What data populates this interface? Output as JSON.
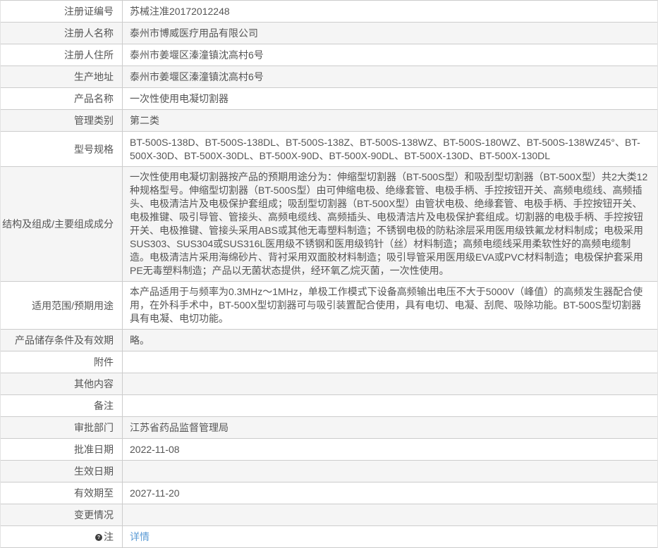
{
  "colors": {
    "link_blue": "#5b9bd5",
    "row_alt_gray": "#f5f5f5",
    "border_gray": "#cccccc",
    "text_gray": "#555555"
  },
  "table": {
    "rows": [
      {
        "label": "注册证编号",
        "value": "苏械注准20172012248"
      },
      {
        "label": "注册人名称",
        "value": "泰州市博威医疗用品有限公司"
      },
      {
        "label": "注册人住所",
        "value": "泰州市姜堰区溱潼镇沈高村6号"
      },
      {
        "label": "生产地址",
        "value": "泰州市姜堰区溱潼镇沈高村6号"
      },
      {
        "label": "产品名称",
        "value": "一次性使用电凝切割器"
      },
      {
        "label": "管理类别",
        "value": "第二类"
      },
      {
        "label": "型号规格",
        "value": "BT-500S-138D、BT-500S-138DL、BT-500S-138Z、BT-500S-138WZ、BT-500S-180WZ、BT-500S-138WZ45°、BT-500X-30D、BT-500X-30DL、BT-500X-90D、BT-500X-90DL、BT-500X-130D、BT-500X-130DL"
      },
      {
        "label": "结构及组成/主要组成成分",
        "value": "一次性使用电凝切割器按产品的预期用途分为：伸缩型切割器（BT-500S型）和吸刮型切割器（BT-500X型）共2大类12种规格型号。伸缩型切割器（BT-500S型）由可伸缩电极、绝缘套管、电极手柄、手控按钮开关、高频电缆线、高频插头、电极清洁片及电极保护套组成；吸刮型切割器（BT-500X型）由管状电极、绝缘套管、电极手柄、手控按钮开关、电极推键、吸引导管、管接头、高频电缆线、高频插头、电极清洁片及电极保护套组成。切割器的电极手柄、手控按钮开关、电极推键、管接头采用ABS或其他无毒塑料制造；不锈钢电极的防粘涂层采用医用级铁氟龙材料制成；电极采用SUS303、SUS304或SUS316L医用级不锈钢和医用级钨针（丝）材料制造；高频电缆线采用柔软性好的高频电缆制造。电极清洁片采用海绵砂片、背衬采用双面胶材料制造；吸引导管采用医用级EVA或PVC材料制造；电极保护套采用PE无毒塑料制造；产品以无菌状态提供，经环氧乙烷灭菌，一次性使用。"
      },
      {
        "label": "适用范围/预期用途",
        "value": "本产品适用于与频率为0.3MHz～1MHz，单极工作模式下设备高频输出电压不大于5000V（峰值）的高频发生器配合使用，在外科手术中，BT-500X型切割器可与吸引装置配合使用，具有电切、电凝、刮爬、吸除功能。BT-500S型切割器具有电凝、电切功能。"
      },
      {
        "label": "产品储存条件及有效期",
        "value": "略。"
      },
      {
        "label": "附件",
        "value": ""
      },
      {
        "label": "其他内容",
        "value": ""
      },
      {
        "label": "备注",
        "value": ""
      },
      {
        "label": "审批部门",
        "value": "江苏省药品监督管理局"
      },
      {
        "label": "批准日期",
        "value": "2022-11-08"
      },
      {
        "label": "生效日期",
        "value": ""
      },
      {
        "label": "有效期至",
        "value": "2027-11-20"
      },
      {
        "label": "变更情况",
        "value": ""
      },
      {
        "label": "注",
        "link": "详情"
      }
    ]
  }
}
